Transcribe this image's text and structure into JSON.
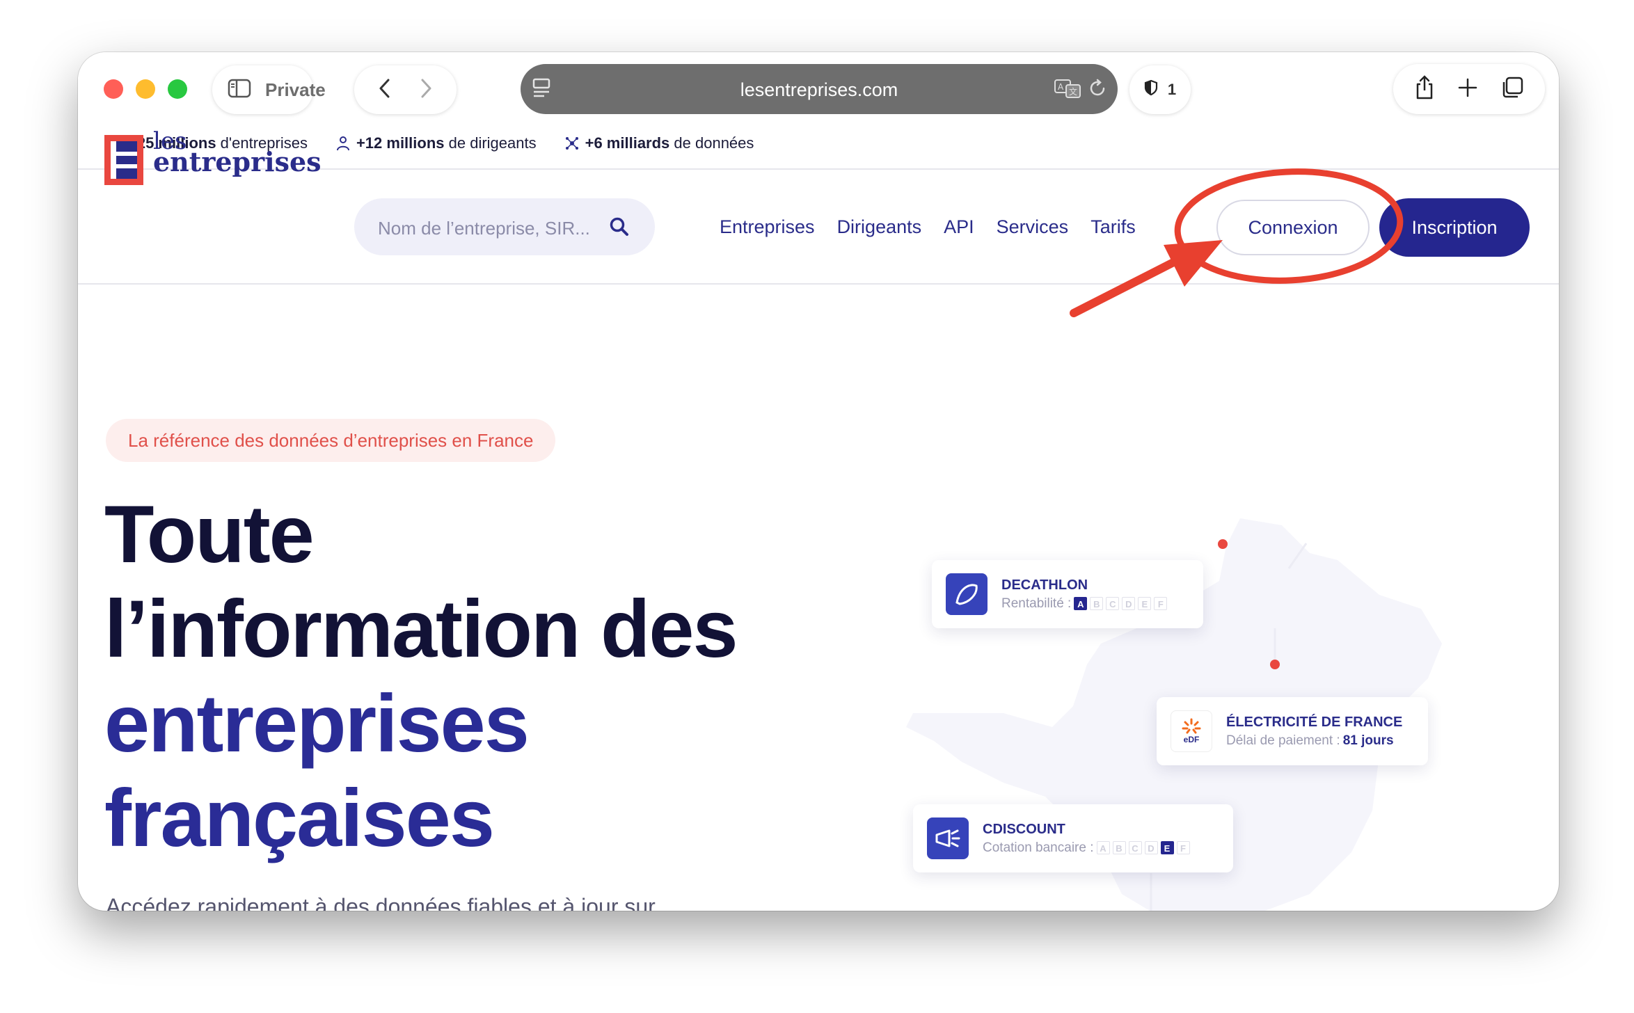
{
  "browser": {
    "private_label": "Private",
    "url": "lesentreprises.com",
    "shield_count": "1"
  },
  "stats": [
    {
      "bold": "+25 millions",
      "rest": " d'entreprises"
    },
    {
      "bold": "+12 millions",
      "rest": " de dirigeants"
    },
    {
      "bold": "+6 milliards",
      "rest": " de données"
    }
  ],
  "header": {
    "logo_line1": "les",
    "logo_line2": "entreprises",
    "search_placeholder": "Nom de l’entreprise, SIR...",
    "nav": [
      "Entreprises",
      "Dirigeants",
      "API",
      "Services",
      "Tarifs"
    ],
    "login_label": "Connexion",
    "signup_label": "Inscription"
  },
  "hero": {
    "tagline": "La référence des données d’entreprises en France",
    "title_line1": "Toute",
    "title_line2": "l’information des",
    "title_line3": "entreprises",
    "title_line4": "françaises",
    "subtext": "Accédez rapidement à des données fiables et à jour sur"
  },
  "cards": {
    "decathlon": {
      "name": "DECATHLON",
      "label": "Rentabilité :",
      "grades": [
        "A",
        "B",
        "C",
        "D",
        "E",
        "F"
      ],
      "active": "A"
    },
    "edf": {
      "name": "ÉLECTRICITÉ DE FRANCE",
      "label": "Délai de paiement :",
      "value": "81 jours",
      "logo_text": "eDF"
    },
    "cdiscount": {
      "name": "CDISCOUNT",
      "label": "Cotation bancaire :",
      "grades": [
        "A",
        "B",
        "C",
        "D",
        "E",
        "F"
      ],
      "active": "E"
    }
  },
  "colors": {
    "brand_navy": "#25268f",
    "brand_red": "#e9473f",
    "annotation_red": "#e8402f"
  }
}
